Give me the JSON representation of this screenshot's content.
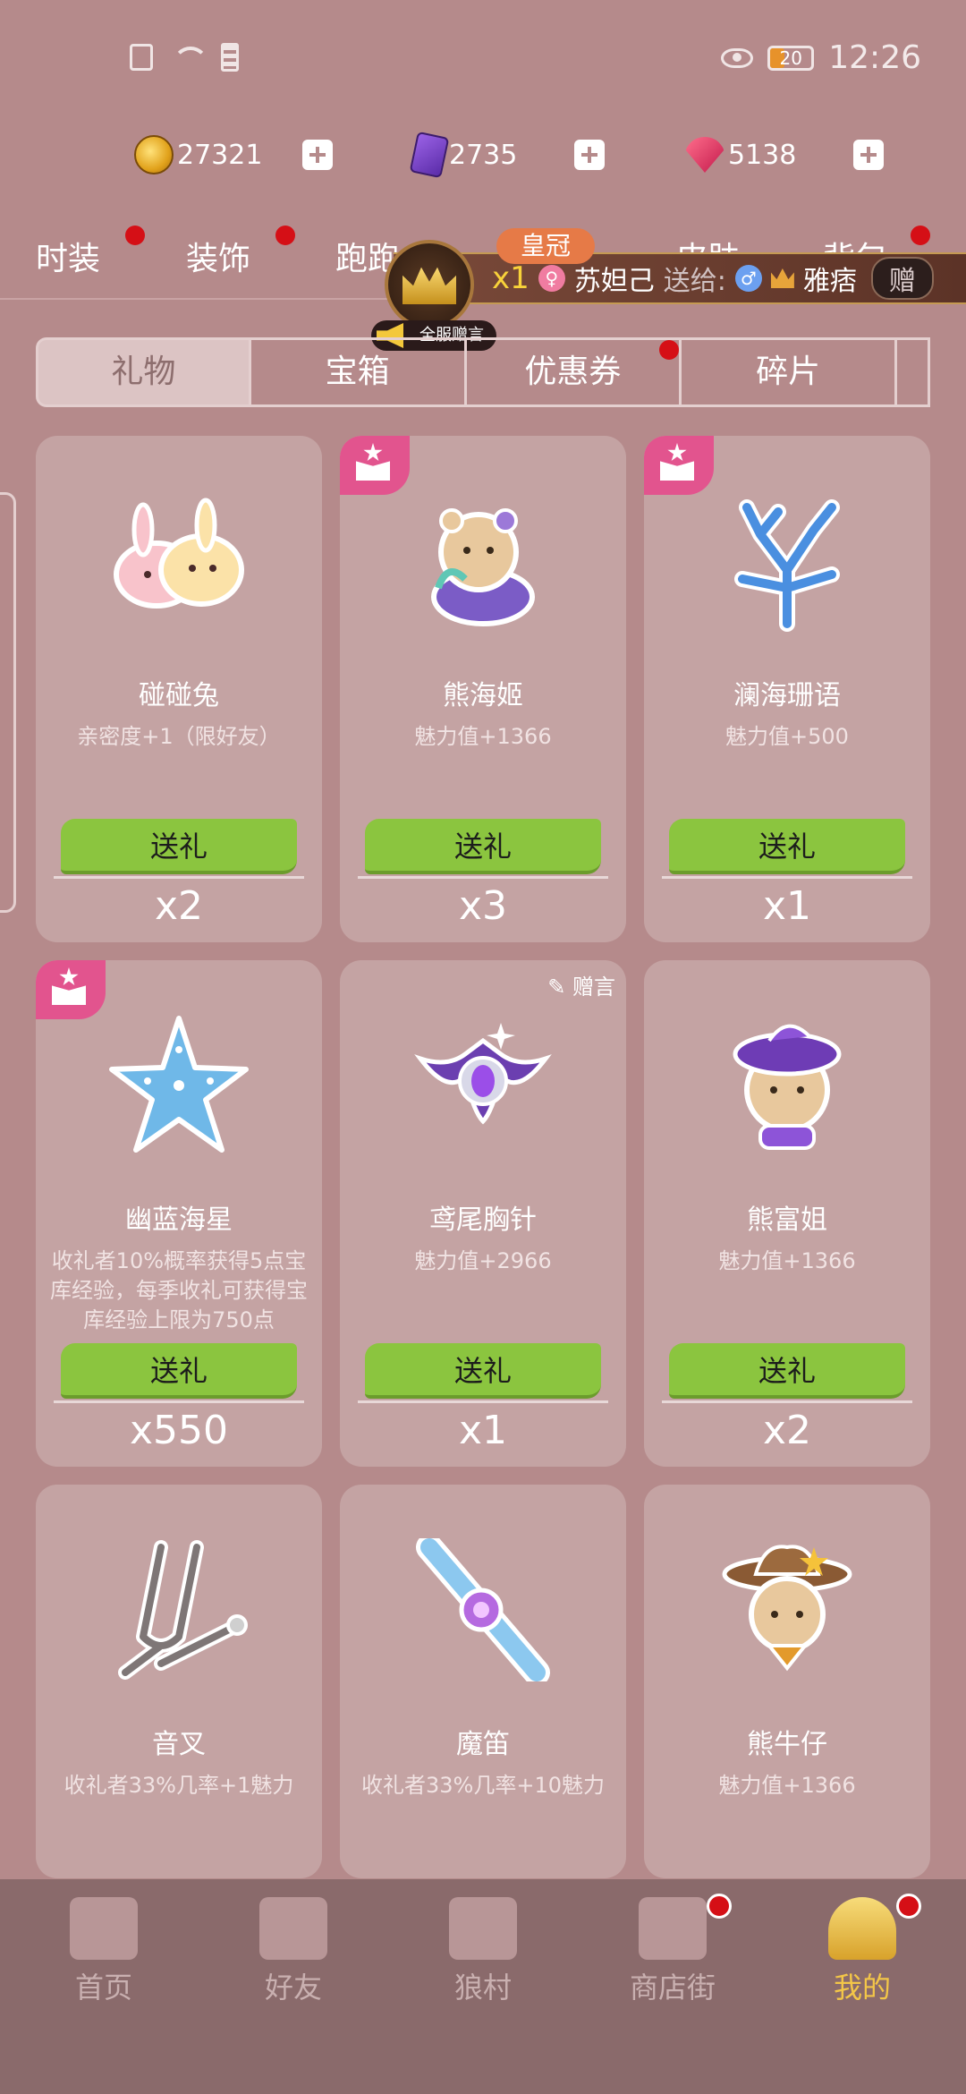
{
  "status_bar": {
    "time": "12:26",
    "battery": "20"
  },
  "currencies": [
    {
      "icon": "gold-coin-icon",
      "value": "27321"
    },
    {
      "icon": "purple-card-icon",
      "value": "2735"
    },
    {
      "icon": "red-gem-icon",
      "value": "5138"
    }
  ],
  "category_tabs": [
    "时装",
    "装饰",
    "跑跑",
    "皮肤",
    "背包"
  ],
  "banner": {
    "tag": "皇冠",
    "count": "x1",
    "sender": "苏妲己",
    "send_to": "送给:",
    "receiver": "雅痞",
    "button": "赠",
    "announce": "全服赠言"
  },
  "sub_tabs": [
    "礼物",
    "宝箱",
    "优惠券",
    "碎片"
  ],
  "items": [
    {
      "name": "碰碰兔",
      "desc": "亲密度+1（限好友）",
      "count": "x2"
    },
    {
      "name": "熊海姬",
      "desc": "魅力值+1366",
      "count": "x3"
    },
    {
      "name": "澜海珊语",
      "desc": "魅力值+500",
      "count": "x1"
    },
    {
      "name": "幽蓝海星",
      "desc": "收礼者10%概率获得5点宝库经验，每季收礼可获得宝库经验上限为750点",
      "count": "x550"
    },
    {
      "name": "鸢尾胸针",
      "desc": "魅力值+2966",
      "count": "x1"
    },
    {
      "name": "熊富姐",
      "desc": "魅力值+1366",
      "count": "x2"
    },
    {
      "name": "音叉",
      "desc": "收礼者33%几率+1魅力",
      "count": ""
    },
    {
      "name": "魔笛",
      "desc": "收礼者33%几率+10魅力",
      "count": ""
    },
    {
      "name": "熊牛仔",
      "desc": "魅力值+1366",
      "count": ""
    }
  ],
  "send_label": "送礼",
  "message_label": "赠言",
  "bottom_nav": [
    "首页",
    "好友",
    "狼村",
    "商店街",
    "我的"
  ],
  "colors": {
    "background": "#b58a8b",
    "send_button": "#8bc53f",
    "active_nav": "#f3c648",
    "red_dot": "#d50f16"
  }
}
